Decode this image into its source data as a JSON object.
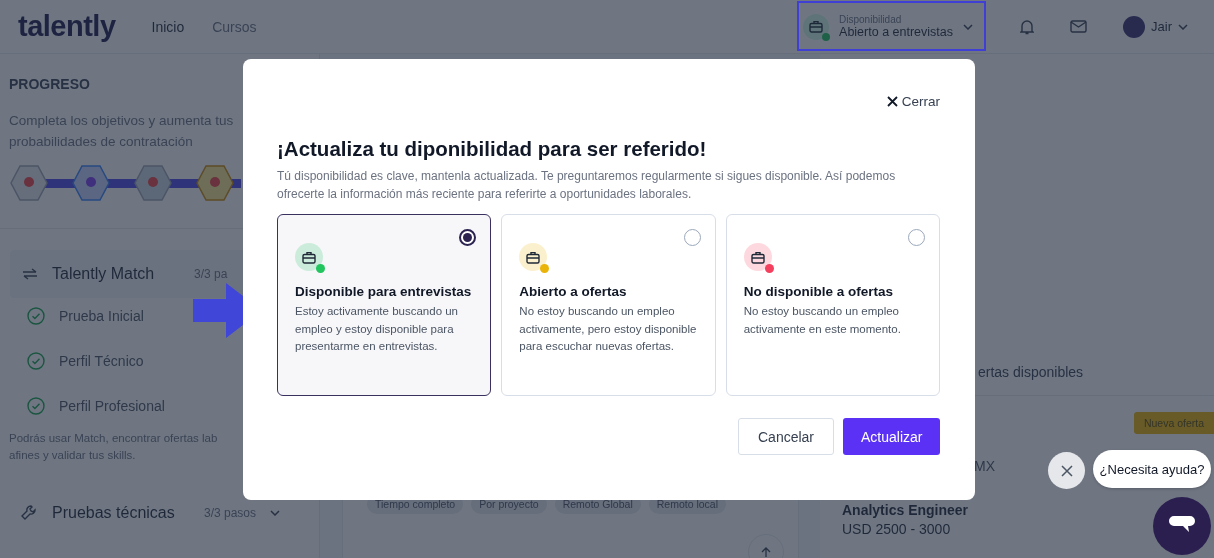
{
  "header": {
    "logo": "talently",
    "nav": [
      {
        "label": "Inicio",
        "selected": true
      },
      {
        "label": "Cursos",
        "selected": false
      }
    ],
    "availability": {
      "label": "Disponibilidad",
      "value": "Abierto a entrevistas"
    },
    "user": {
      "name": "Jair"
    }
  },
  "sidebar": {
    "title": "PROGRESO",
    "description_lines": [
      "Completa los objetivos y aumenta tus",
      "probabilidades de contratación"
    ],
    "sections": [
      {
        "title": "Talently Match",
        "count": "3/3 pa",
        "steps": [
          {
            "label": "Prueba Inicial",
            "done": true
          },
          {
            "label": "Perfil Técnico",
            "done": true
          },
          {
            "label": "Perfil Profesional",
            "done": true
          }
        ],
        "note_lines": [
          "Podrás usar Match, encontrar ofertas lab",
          "afines y validar tus skills."
        ]
      },
      {
        "title": "Pruebas técnicas",
        "count": "3/3 pasos"
      }
    ]
  },
  "offers": {
    "heading": "ertas disponibles",
    "tags": [
      "Tiempo completo",
      "Por proyecto",
      "Remoto Global",
      "Remoto local"
    ],
    "badge": "Nueva oferta",
    "location": "MX",
    "job": {
      "title": "Analytics Engineer",
      "salary": "USD 2500 - 3000"
    }
  },
  "modal": {
    "close": "Cerrar",
    "title": "¡Actualiza tu diponibilidad para ser referido!",
    "description": "Tú disponibilidad es clave, mantenla actualizada. Te preguntaremos regularmente si sigues disponible. Así podemos ofrecerte la información más reciente para referirte a oportunidades laborales.",
    "options": [
      {
        "title": "Disponible para entrevistas",
        "description": "Estoy activamente buscando un empleo y estoy disponible para presentarme en entrevistas.",
        "color": "#22c55e",
        "selected": true
      },
      {
        "title": "Abierto a ofertas",
        "description": "No estoy buscando un empleo activamente, pero estoy disponible para escuchar nuevas ofertas.",
        "color": "#eab308",
        "selected": false
      },
      {
        "title": "No disponible a ofertas",
        "description": "No estoy buscando un empleo activamente en este momento.",
        "color": "#f43f5e",
        "selected": false
      }
    ],
    "buttons": [
      {
        "label": "Cancelar",
        "kind": "secondary"
      },
      {
        "label": "Actualizar",
        "kind": "primary"
      }
    ]
  },
  "chat": {
    "prompt": "¿Necesita ayuda?"
  }
}
